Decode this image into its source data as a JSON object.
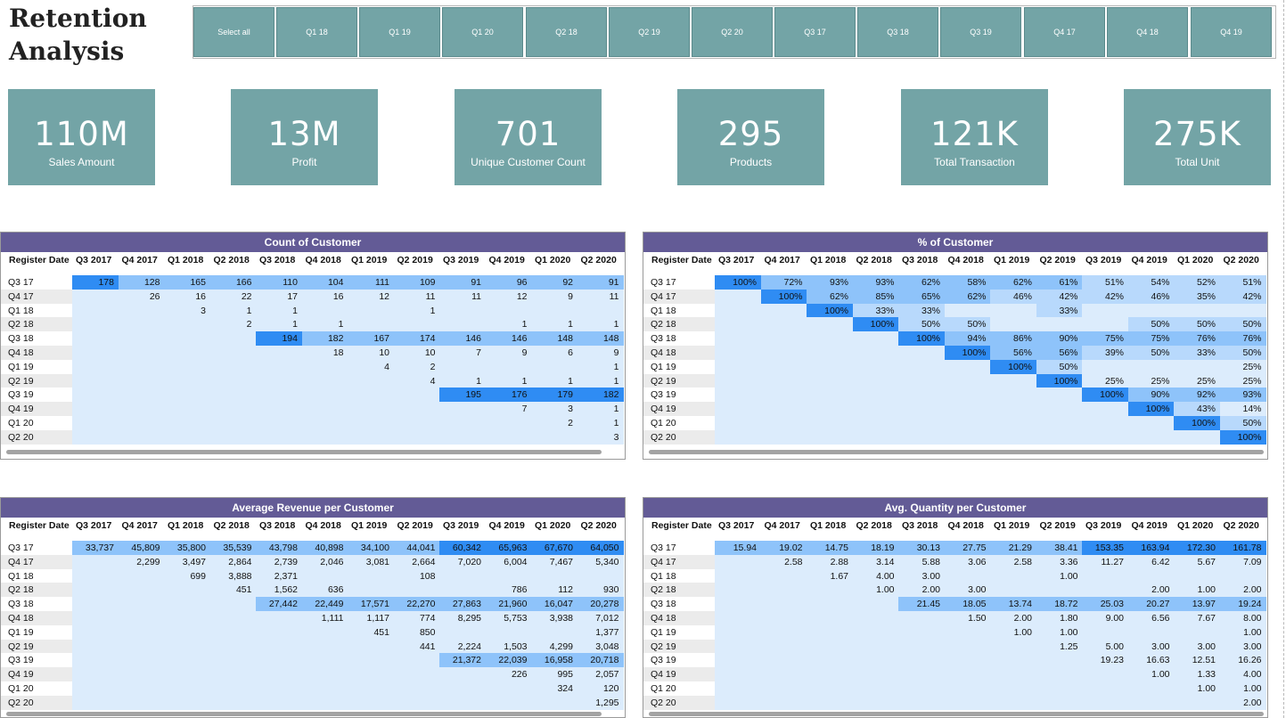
{
  "page": {
    "title": "Retention\nAnalysis"
  },
  "slicer": [
    "Select all",
    "Q1 18",
    "Q1 19",
    "Q1 20",
    "Q2 18",
    "Q2 19",
    "Q2 20",
    "Q3 17",
    "Q3 18",
    "Q3 19",
    "Q4 17",
    "Q4 18",
    "Q4 19"
  ],
  "kpis": [
    {
      "value": "110M",
      "label": "Sales Amount"
    },
    {
      "value": "13M",
      "label": "Profit"
    },
    {
      "value": "701",
      "label": "Unique Customer Count"
    },
    {
      "value": "295",
      "label": "Products"
    },
    {
      "value": "121K",
      "label": "Total Transaction"
    },
    {
      "value": "275K",
      "label": "Total Unit"
    }
  ],
  "colors": {
    "tile": "#73a4a6",
    "header": "#635b96",
    "light": "#dcecfc",
    "medium": "#8ec3fa",
    "dark": "#2f8cf3",
    "band": "#ebebeb"
  },
  "matrix_columns": [
    "Q3 2017",
    "Q4 2017",
    "Q1 2018",
    "Q2 2018",
    "Q3 2018",
    "Q4 2018",
    "Q1 2019",
    "Q2 2019",
    "Q3 2019",
    "Q4 2019",
    "Q1 2020",
    "Q2 2020"
  ],
  "matrix_rows": [
    "Q3 17",
    "Q4 17",
    "Q1 18",
    "Q2 18",
    "Q3 18",
    "Q4 18",
    "Q1 19",
    "Q2 19",
    "Q3 19",
    "Q4 19",
    "Q1 20",
    "Q2 20"
  ],
  "matrices": [
    {
      "title": "Count of Customer",
      "row_header": "Register Date",
      "rows": [
        [
          "178",
          "128",
          "165",
          "166",
          "110",
          "104",
          "111",
          "109",
          "91",
          "96",
          "92",
          "91"
        ],
        [
          "",
          "26",
          "16",
          "22",
          "17",
          "16",
          "12",
          "11",
          "11",
          "12",
          "9",
          "11"
        ],
        [
          "",
          "",
          "3",
          "1",
          "1",
          "",
          "",
          "1",
          "",
          "",
          "",
          ""
        ],
        [
          "",
          "",
          "",
          "2",
          "1",
          "1",
          "",
          "",
          "",
          "1",
          "1",
          "1"
        ],
        [
          "",
          "",
          "",
          "",
          "194",
          "182",
          "167",
          "174",
          "146",
          "146",
          "148",
          "148"
        ],
        [
          "",
          "",
          "",
          "",
          "",
          "18",
          "10",
          "10",
          "7",
          "9",
          "6",
          "9"
        ],
        [
          "",
          "",
          "",
          "",
          "",
          "",
          "4",
          "2",
          "",
          "",
          "",
          "1"
        ],
        [
          "",
          "",
          "",
          "",
          "",
          "",
          "",
          "4",
          "1",
          "1",
          "1",
          "1"
        ],
        [
          "",
          "",
          "",
          "",
          "",
          "",
          "",
          "",
          "195",
          "176",
          "179",
          "182"
        ],
        [
          "",
          "",
          "",
          "",
          "",
          "",
          "",
          "",
          "",
          "7",
          "3",
          "1"
        ],
        [
          "",
          "",
          "",
          "",
          "",
          "",
          "",
          "",
          "",
          "",
          "2",
          "1"
        ],
        [
          "",
          "",
          "",
          "",
          "",
          "",
          "",
          "",
          "",
          "",
          "",
          "3"
        ]
      ]
    },
    {
      "title": "% of Customer",
      "row_header": "Register Date",
      "rows": [
        [
          "100%",
          "72%",
          "93%",
          "93%",
          "62%",
          "58%",
          "62%",
          "61%",
          "51%",
          "54%",
          "52%",
          "51%"
        ],
        [
          "",
          "100%",
          "62%",
          "85%",
          "65%",
          "62%",
          "46%",
          "42%",
          "42%",
          "46%",
          "35%",
          "42%"
        ],
        [
          "",
          "",
          "100%",
          "33%",
          "33%",
          "",
          "",
          "33%",
          "",
          "",
          "",
          ""
        ],
        [
          "",
          "",
          "",
          "100%",
          "50%",
          "50%",
          "",
          "",
          "",
          "50%",
          "50%",
          "50%"
        ],
        [
          "",
          "",
          "",
          "",
          "100%",
          "94%",
          "86%",
          "90%",
          "75%",
          "75%",
          "76%",
          "76%"
        ],
        [
          "",
          "",
          "",
          "",
          "",
          "100%",
          "56%",
          "56%",
          "39%",
          "50%",
          "33%",
          "50%"
        ],
        [
          "",
          "",
          "",
          "",
          "",
          "",
          "100%",
          "50%",
          "",
          "",
          "",
          "25%"
        ],
        [
          "",
          "",
          "",
          "",
          "",
          "",
          "",
          "100%",
          "25%",
          "25%",
          "25%",
          "25%"
        ],
        [
          "",
          "",
          "",
          "",
          "",
          "",
          "",
          "",
          "100%",
          "90%",
          "92%",
          "93%"
        ],
        [
          "",
          "",
          "",
          "",
          "",
          "",
          "",
          "",
          "",
          "100%",
          "43%",
          "14%"
        ],
        [
          "",
          "",
          "",
          "",
          "",
          "",
          "",
          "",
          "",
          "",
          "100%",
          "50%"
        ],
        [
          "",
          "",
          "",
          "",
          "",
          "",
          "",
          "",
          "",
          "",
          "",
          "100%"
        ]
      ]
    },
    {
      "title": "Average Revenue per Customer",
      "row_header": "Register Date",
      "rows": [
        [
          "33,737",
          "45,809",
          "35,800",
          "35,539",
          "43,798",
          "40,898",
          "34,100",
          "44,041",
          "60,342",
          "65,963",
          "67,670",
          "64,050"
        ],
        [
          "",
          "2,299",
          "3,497",
          "2,864",
          "2,739",
          "2,046",
          "3,081",
          "2,664",
          "7,020",
          "6,004",
          "7,467",
          "5,340"
        ],
        [
          "",
          "",
          "699",
          "3,888",
          "2,371",
          "",
          "",
          "108",
          "",
          "",
          "",
          ""
        ],
        [
          "",
          "",
          "",
          "451",
          "1,562",
          "636",
          "",
          "",
          "",
          "786",
          "112",
          "930"
        ],
        [
          "",
          "",
          "",
          "",
          "27,442",
          "22,449",
          "17,571",
          "22,270",
          "27,863",
          "21,960",
          "16,047",
          "20,278"
        ],
        [
          "",
          "",
          "",
          "",
          "",
          "1,111",
          "1,117",
          "774",
          "8,295",
          "5,753",
          "3,938",
          "7,012"
        ],
        [
          "",
          "",
          "",
          "",
          "",
          "",
          "451",
          "850",
          "",
          "",
          "",
          "1,377"
        ],
        [
          "",
          "",
          "",
          "",
          "",
          "",
          "",
          "441",
          "2,224",
          "1,503",
          "4,299",
          "3,048"
        ],
        [
          "",
          "",
          "",
          "",
          "",
          "",
          "",
          "",
          "21,372",
          "22,039",
          "16,958",
          "20,718"
        ],
        [
          "",
          "",
          "",
          "",
          "",
          "",
          "",
          "",
          "",
          "226",
          "995",
          "2,057"
        ],
        [
          "",
          "",
          "",
          "",
          "",
          "",
          "",
          "",
          "",
          "",
          "324",
          "120"
        ],
        [
          "",
          "",
          "",
          "",
          "",
          "",
          "",
          "",
          "",
          "",
          "",
          "1,295"
        ]
      ]
    },
    {
      "title": "Avg. Quantity per Customer",
      "row_header": "Register Date",
      "rows": [
        [
          "15.94",
          "19.02",
          "14.75",
          "18.19",
          "30.13",
          "27.75",
          "21.29",
          "38.41",
          "153.35",
          "163.94",
          "172.30",
          "161.78"
        ],
        [
          "",
          "2.58",
          "2.88",
          "3.14",
          "5.88",
          "3.06",
          "2.58",
          "3.36",
          "11.27",
          "6.42",
          "5.67",
          "7.09"
        ],
        [
          "",
          "",
          "1.67",
          "4.00",
          "3.00",
          "",
          "",
          "1.00",
          "",
          "",
          "",
          ""
        ],
        [
          "",
          "",
          "",
          "1.00",
          "2.00",
          "3.00",
          "",
          "",
          "",
          "2.00",
          "1.00",
          "2.00"
        ],
        [
          "",
          "",
          "",
          "",
          "21.45",
          "18.05",
          "13.74",
          "18.72",
          "25.03",
          "20.27",
          "13.97",
          "19.24"
        ],
        [
          "",
          "",
          "",
          "",
          "",
          "1.50",
          "2.00",
          "1.80",
          "9.00",
          "6.56",
          "7.67",
          "8.00"
        ],
        [
          "",
          "",
          "",
          "",
          "",
          "",
          "1.00",
          "1.00",
          "",
          "",
          "",
          "1.00"
        ],
        [
          "",
          "",
          "",
          "",
          "",
          "",
          "",
          "1.25",
          "5.00",
          "3.00",
          "3.00",
          "3.00"
        ],
        [
          "",
          "",
          "",
          "",
          "",
          "",
          "",
          "",
          "19.23",
          "16.63",
          "12.51",
          "16.26"
        ],
        [
          "",
          "",
          "",
          "",
          "",
          "",
          "",
          "",
          "",
          "1.00",
          "1.33",
          "4.00"
        ],
        [
          "",
          "",
          "",
          "",
          "",
          "",
          "",
          "",
          "",
          "",
          "1.00",
          "1.00"
        ],
        [
          "",
          "",
          "",
          "",
          "",
          "",
          "",
          "",
          "",
          "",
          "",
          "2.00"
        ]
      ]
    }
  ]
}
